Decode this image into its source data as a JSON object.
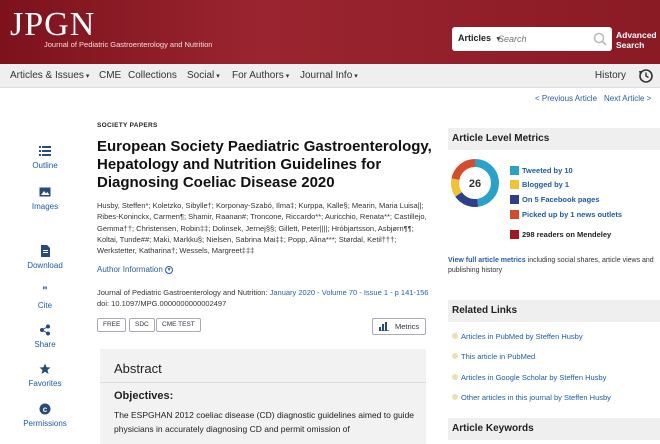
{
  "header": {
    "logo_text": "JPGN",
    "logo_sub": "Journal of Pediatric Gastroenterology and Nutrition",
    "search_scope": "Articles",
    "search_placeholder": "Search",
    "advanced_line1": "Advanced",
    "advanced_line2": "Search"
  },
  "nav": {
    "items": [
      "Articles & Issues",
      "CME",
      "Collections",
      "Social",
      "For Authors",
      "Journal Info"
    ],
    "history": "History"
  },
  "article_nav": {
    "prev": "< Previous Article",
    "next": "Next Article >"
  },
  "sidebar": {
    "items": [
      "Outline",
      "Images",
      "Download",
      "Cite",
      "Share",
      "Favorites",
      "Permissions"
    ]
  },
  "article": {
    "section": "SOCIETY PAPERS",
    "title": "European Society Paediatric Gastroenterology, Hepatology and Nutrition Guidelines for Diagnosing Coeliac Disease 2020",
    "authors": "Husby, Steffen*; Koletzko, Sibylle†; Korponay-Szabó, Ilma‡; Kurppa, Kalle§; Mearin, Maria Luisa||; Ribes-Koninckx, Carmen¶; Shamir, Raanan#; Troncone, Riccardo**; Auricchio, Renata**; Castillejo, Gemma††; Christensen, Robin‡‡; Dolinsek, Jernej§§; Gillett, Peter||||; Hróbjartsson, Asbjørn¶¶; Koltai, Tunde##; Maki, Markku§; Nielsen, Sabrina Mai‡‡; Popp, Alina***; Størdal, Ketil†††; Werkstetter, Katharina†; Wessels, Margreet‡‡‡",
    "author_info": "Author Information",
    "journal": "Journal of Pediatric Gastroenterology and Nutrition:",
    "issue": "January 2020 - Volume 70 - Issue 1 - p 141-156",
    "doi": "doi: 10.1097/MPG.0000000000002497",
    "tags": [
      "FREE",
      "SDC",
      "CME TEST"
    ],
    "metrics_button": "Metrics"
  },
  "abstract": {
    "heading": "Abstract",
    "objectives_heading": "Objectives:",
    "objectives_text": "The ESPGHAN 2012 coeliac disease (CD) diagnostic guidelines aimed to guide physicians in accurately diagnosing CD and permit omission of"
  },
  "right": {
    "alm_heading": "Article Level Metrics",
    "altmetric_score": "26",
    "metrics": [
      {
        "text": "Tweeted by 10",
        "color": "#2aa1c9"
      },
      {
        "text": "Blogged by 1",
        "color": "#f1c232"
      },
      {
        "text": "On 5 Facebook pages",
        "color": "#2d3f8a"
      },
      {
        "text": "Picked up by 1 news outlets",
        "color": "#d84b2a"
      },
      {
        "text": "298 readers on Mendeley",
        "color": "#a4161f"
      }
    ],
    "view_all_link": "View full article metrics",
    "view_all_rest": " including social shares, article views and publishing history",
    "related_heading": "Related Links",
    "related": [
      "Articles in PubMed by Steffen Husby",
      "This article in PubMed",
      "Articles in Google Scholar by Steffen Husby",
      "Other articles in this journal by Steffen Husby"
    ],
    "keywords_heading": "Article Keywords"
  }
}
